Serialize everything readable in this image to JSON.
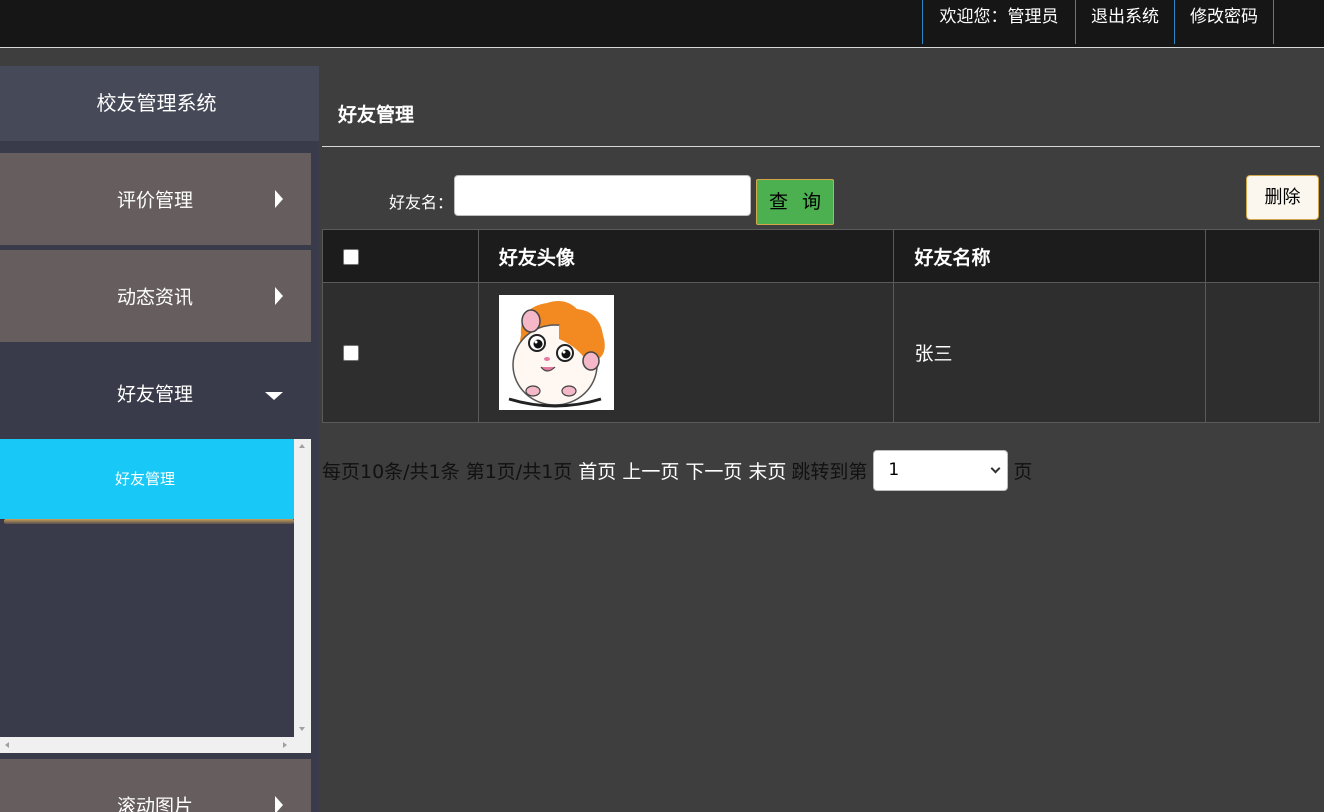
{
  "header": {
    "welcome": "欢迎您：管理员",
    "logout": "退出系统",
    "change_password": "修改密码"
  },
  "sidebar": {
    "title": "校友管理系统",
    "menus": [
      {
        "label": "评价管理",
        "state": "collapsed"
      },
      {
        "label": "动态资讯",
        "state": "collapsed"
      },
      {
        "label": "好友管理",
        "state": "expanded",
        "submenu": [
          {
            "label": "好友管理",
            "active": true
          }
        ]
      },
      {
        "label": "滚动图片",
        "state": "collapsed"
      }
    ]
  },
  "main": {
    "page_title": "好友管理",
    "search": {
      "label": "好友名：",
      "value": "",
      "placeholder": "",
      "button": "查 询"
    },
    "delete_button": "删除",
    "table": {
      "columns": [
        "",
        "好友头像",
        "好友名称",
        ""
      ],
      "rows": [
        {
          "avatar": "hamster-avatar",
          "name": "张三"
        }
      ]
    },
    "pager": {
      "info": "每页10条/共1条 第1页/共1页",
      "first": "首页",
      "prev": "上一页",
      "next": "下一页",
      "last": "末页",
      "jump_label": "跳转到第",
      "page_value": "1",
      "page_unit": "页"
    }
  },
  "colors": {
    "accent": "#18c8f6",
    "search_button": "#4caf50",
    "menu_closed": "#665d5f",
    "sidebar_bg": "#393a4a"
  }
}
